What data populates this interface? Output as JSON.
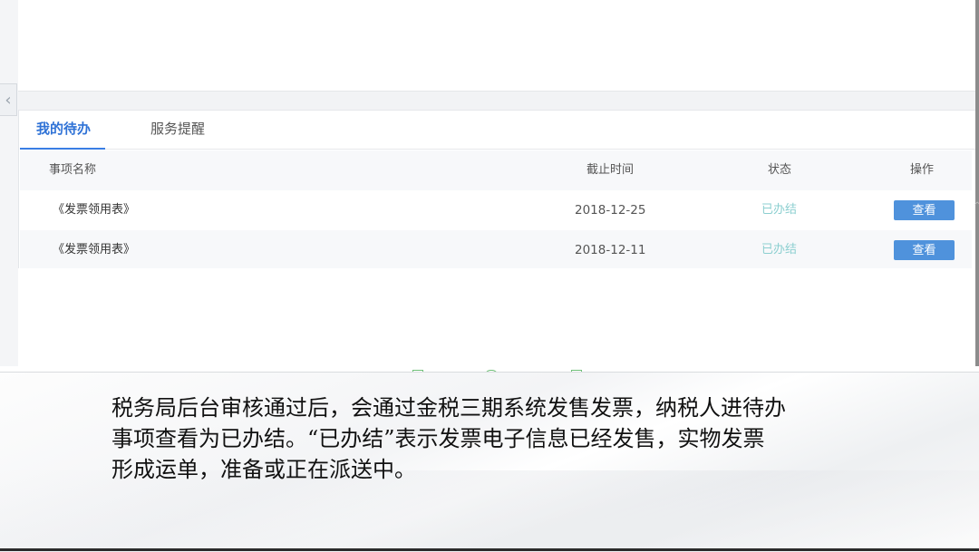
{
  "tabs": [
    {
      "label": "我的待办",
      "active": true
    },
    {
      "label": "服务提醒",
      "active": false
    }
  ],
  "table": {
    "headers": {
      "name": "事项名称",
      "deadline": "截止时间",
      "status": "状态",
      "action": "操作"
    },
    "rows": [
      {
        "name": "《发票领用表》",
        "deadline": "2018-12-25",
        "status": "已办结",
        "action": "查看"
      },
      {
        "name": "《发票领用表》",
        "deadline": "2018-12-11",
        "status": "已办结",
        "action": "查看"
      }
    ]
  },
  "caption": {
    "lines": [
      "税务局后台审核通过后，会通过金税三期系统发售发票，纳税人进待办",
      "事项查看为已办结。“已办结”表示发票电子信息已经发售，实物发票",
      "形成运单，准备或正在派送中。"
    ]
  },
  "icons": {
    "collapse": "chevron-left-icon"
  },
  "colors": {
    "accent": "#3a7ee4",
    "button": "#4f92dc",
    "status_done": "#8ccfd0"
  }
}
